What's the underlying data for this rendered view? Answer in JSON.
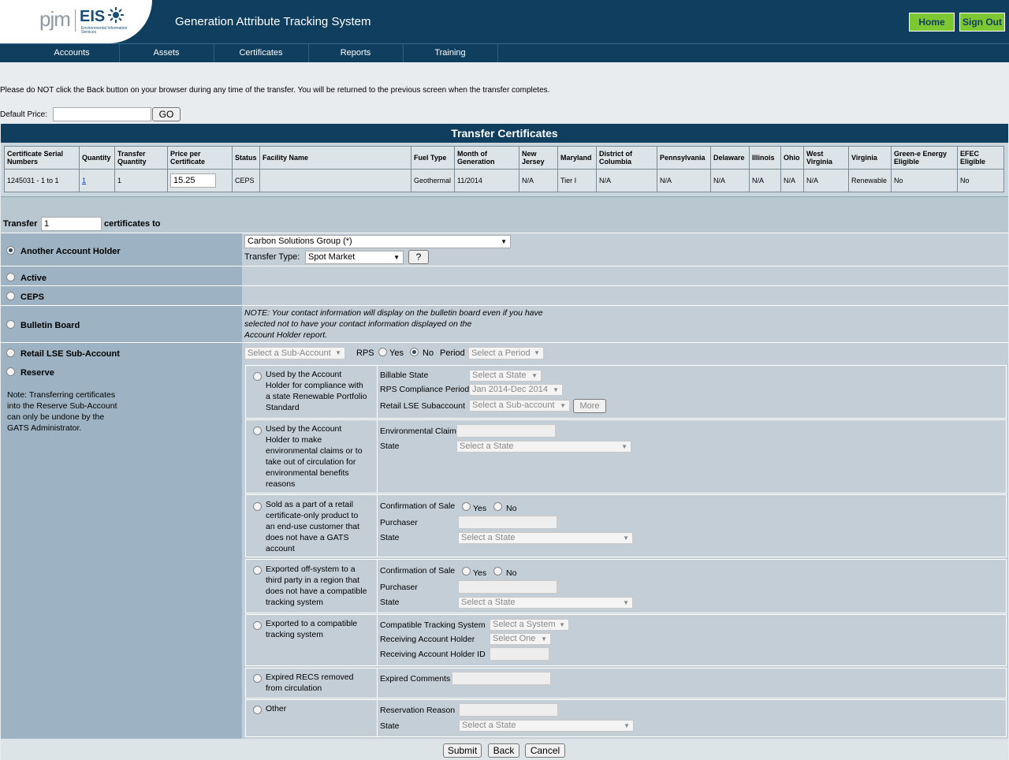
{
  "header": {
    "logo_pjm": "pjm",
    "logo_eis": "EIS",
    "logo_sub": "Environmental Information Services",
    "title": "Generation Attribute Tracking System",
    "home": "Home",
    "signout": "Sign Out"
  },
  "nav": [
    "Accounts",
    "Assets",
    "Certificates",
    "Reports",
    "Training"
  ],
  "warning": "Please do NOT click the Back button on your browser during any time of the transfer. You will be returned to the previous screen when the transfer completes.",
  "default_price": {
    "label": "Default Price:",
    "value": "",
    "go": "GO"
  },
  "table": {
    "title": "Transfer Certificates",
    "headers": [
      "Certificate Serial Numbers",
      "Quantity",
      "Transfer Quantity",
      "Price per Certificate",
      "Status",
      "Facility Name",
      "Fuel Type",
      "Month of Generation",
      "New Jersey",
      "Maryland",
      "District of Columbia",
      "Pennsylvania",
      "Delaware",
      "Illinois",
      "Ohio",
      "West Virginia",
      "Virginia",
      "Green-e Energy Eligible",
      "EFEC Eligible"
    ],
    "row": {
      "serial": "1245031 - 1 to 1",
      "quantity": "1",
      "transfer_quantity": "1",
      "price": "15.25",
      "status": "CEPS",
      "facility": "",
      "fuel": "Geothermal",
      "month": "11/2014",
      "nj": "N/A",
      "md": "Tier I",
      "dc": "N/A",
      "pa": "N/A",
      "de": "N/A",
      "il": "N/A",
      "oh": "N/A",
      "wv": "N/A",
      "va": "Renewable",
      "greene": "No",
      "efec": "No"
    }
  },
  "transfer": {
    "prefix": "Transfer",
    "count": "1",
    "suffix": "certificates to",
    "another": "Another Account Holder",
    "account_holder": "Carbon Solutions Group (*)",
    "transfer_type_label": "Transfer Type:",
    "transfer_type": "Spot Market",
    "help": "?",
    "active": "Active",
    "ceps": "CEPS",
    "bulletin": "Bulletin Board",
    "bulletin_note_1": "NOTE: Your contact information will display on the bulletin board even if you have",
    "bulletin_note_2": "selected not to have your contact information displayed on the",
    "bulletin_note_3": "Account Holder report.",
    "retail": "Retail LSE Sub-Account",
    "retail_select": "Select a Sub-Account",
    "rps": "RPS",
    "yes": "Yes",
    "no": "No",
    "period": "Period",
    "period_select": "Select a Period",
    "reserve": "Reserve",
    "reserve_note": [
      "Note: Transferring certificates",
      "into the Reserve Sub-Account",
      "can only be undone by the",
      "GATS Administrator."
    ]
  },
  "reserve_options": [
    {
      "text": [
        "Used by the Account",
        "Holder for compliance with",
        "a state Renewable Portfolio",
        "Standard"
      ],
      "fields": {
        "billable_state": "Billable State",
        "billable_sel": "Select a State",
        "rps_period": "RPS Compliance Period",
        "rps_sel": "Jan 2014-Dec 2014",
        "subacct": "Retail LSE Subaccount",
        "subacct_sel": "Select a Sub-account",
        "more": "More"
      }
    },
    {
      "text": [
        "Used by the Account",
        "Holder to make",
        "environmental claims or to",
        "take out of circulation for",
        "environmental benefits",
        "reasons"
      ],
      "fields": {
        "claim": "Environmental Claim",
        "state": "State",
        "state_sel": "Select a State"
      }
    },
    {
      "text": [
        "Sold as a part of a retail",
        "certificate-only product to",
        "an end-use customer that",
        "does not have a GATS",
        "account"
      ],
      "fields": {
        "conf": "Confirmation of Sale",
        "yes": "Yes",
        "no": "No",
        "purchaser": "Purchaser",
        "state": "State",
        "state_sel": "Select a State"
      }
    },
    {
      "text": [
        "Exported off-system to a",
        "third party in a region that",
        "does not have a compatible",
        "tracking system"
      ],
      "fields": {
        "conf": "Confirmation of Sale",
        "yes": "Yes",
        "no": "No",
        "purchaser": "Purchaser",
        "state": "State",
        "state_sel": "Select a State"
      }
    },
    {
      "text": [
        "Exported to a compatible",
        "tracking system"
      ],
      "fields": {
        "system": "Compatible Tracking System",
        "system_sel": "Select a System",
        "holder": "Receiving Account Holder",
        "holder_sel": "Select One",
        "holder_id": "Receiving Account Holder ID"
      }
    },
    {
      "text": [
        "Expired RECS removed",
        "from circulation"
      ],
      "fields": {
        "comments": "Expired Comments"
      }
    },
    {
      "text": [
        "Other"
      ],
      "fields": {
        "reason": "Reservation Reason",
        "state": "State",
        "state_sel": "Select a State"
      }
    }
  ],
  "buttons": {
    "submit": "Submit",
    "back": "Back",
    "cancel": "Cancel"
  }
}
